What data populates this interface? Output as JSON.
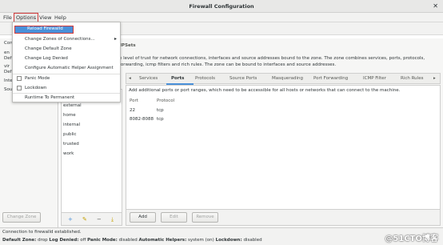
{
  "window": {
    "title": "Firewall Configuration",
    "close_glyph": "✕"
  },
  "menubar": {
    "file": "File",
    "options": "Options",
    "view": "View",
    "help": "Help"
  },
  "left_pane": {
    "header_fragment": "Conf",
    "row1": "en",
    "row2": "Def",
    "row3": "vir",
    "row4": "Def",
    "inter": "Inter",
    "sour": "Sour",
    "change_zone": "Change Zone"
  },
  "panel_header": "IPSets",
  "description": {
    "line1": "e level of trust for network connections, interfaces and source addresses bound to the zone. The zone combines services, ports, protocols,",
    "line2": "forwarding, icmp filters and rich rules. The zone can be bound to interfaces and source addresses."
  },
  "zones": [
    "external",
    "home",
    "internal",
    "public",
    "trusted",
    "work"
  ],
  "zone_actions": {
    "add": "+",
    "edit": "✎",
    "remove": "−",
    "load": "⤓"
  },
  "tabs": {
    "prev": "◂",
    "items": [
      "Services",
      "Ports",
      "Protocols",
      "Source Ports",
      "Masquerading",
      "Port Forwarding",
      "ICMP Filter",
      "Rich Rules"
    ],
    "next": "▸",
    "active": "Ports"
  },
  "ports": {
    "hint": "Add additional ports or port ranges, which need to be accessible for all hosts or networks that can connect to the machine.",
    "headers": {
      "port": "Port",
      "protocol": "Protocol"
    },
    "rows": [
      {
        "port": "22",
        "protocol": "tcp"
      },
      {
        "port": "8082-8088",
        "protocol": "tcp"
      }
    ],
    "buttons": {
      "add": "Add",
      "edit": "Edit",
      "remove": "Remove"
    }
  },
  "status": {
    "line1": "Connection to firewalld established.",
    "default_zone_label": "Default Zone:",
    "default_zone": "drop",
    "log_denied_label": "Log Denied:",
    "log_denied": "off",
    "panic_label": "Panic Mode:",
    "panic": "disabled",
    "helpers_label": "Automatic Helpers:",
    "helpers": "system (on)",
    "lockdown_label": "Lockdown:",
    "lockdown": "disabled"
  },
  "options_menu": {
    "reload": "Reload Firewalld",
    "change_zones": "Change Zones of Connections...",
    "change_default": "Change Default Zone",
    "change_log": "Change Log Denied",
    "configure_helper": "Configure Automatic Helper Assignment",
    "panic": "Panic Mode",
    "lockdown": "Lockdown",
    "runtime": "Runtime To Permanent"
  },
  "watermark": "@51CTO博客",
  "colors": {
    "accent": "#4a90d9",
    "highlight_border": "#d03a3a"
  }
}
